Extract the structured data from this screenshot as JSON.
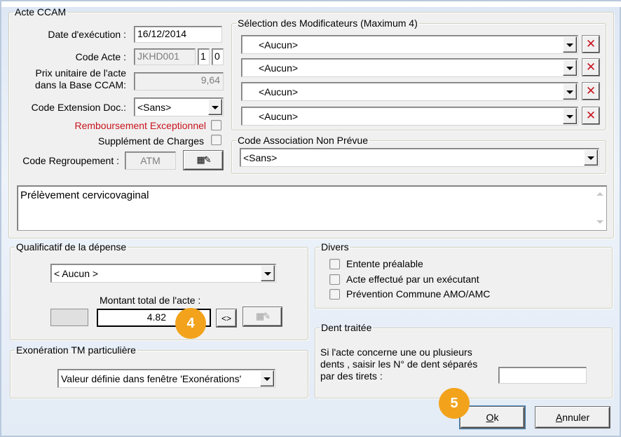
{
  "acte": {
    "legend": "Acte CCAM",
    "date_label": "Date d'exécution :",
    "date_value": "16/12/2014",
    "code_label": "Code Acte :",
    "code_value": "JKHD001",
    "code_phase": "1",
    "code_activite": "0",
    "prix_label_1": "Prix unitaire de l'acte",
    "prix_label_2": "dans la Base CCAM:",
    "prix_value": "9,64",
    "ext_label": "Code Extension Doc.:",
    "ext_value": "<Sans>",
    "remb_label": "Remboursement Exceptionnel",
    "supp_label": "Supplément de Charges",
    "regroup_label": "Code Regroupement :",
    "regroup_value": "ATM",
    "description": "Prélèvement cervicovaginal"
  },
  "modificateurs": {
    "legend": "Sélection des Modificateurs (Maximum 4)",
    "items": [
      {
        "value": "<Aucun>"
      },
      {
        "value": "<Aucun>"
      },
      {
        "value": "<Aucun>"
      },
      {
        "value": "<Aucun>"
      }
    ],
    "delete_glyph": "✕"
  },
  "association": {
    "legend": "Code Association Non Prévue",
    "value": "<Sans>"
  },
  "qualificatif": {
    "legend": "Qualificatif de la dépense",
    "value": "< Aucun >",
    "montant_label": "Montant total de l'acte :",
    "montant_value": "4.82",
    "swap_button": "<>"
  },
  "divers": {
    "legend": "Divers",
    "options": [
      {
        "label": "Entente préalable"
      },
      {
        "label": "Acte effectué par un exécutant"
      },
      {
        "label": "Prévention Commune AMO/AMC"
      }
    ]
  },
  "dent": {
    "legend": "Dent traitée",
    "instruction_1": "Si l'acte concerne une ou plusieurs",
    "instruction_2": "dents , saisir les N° de dent séparés",
    "instruction_3": "par des tirets :",
    "value": ""
  },
  "exoneration": {
    "legend": "Exonération TM particulière",
    "value": "Valeur définie dans fenêtre 'Exonérations'"
  },
  "buttons": {
    "ok_accel": "O",
    "ok_rest": "k",
    "cancel_accel": "A",
    "cancel_rest": "nnuler"
  },
  "badges": {
    "step4": "4",
    "step5": "5"
  },
  "icons": {
    "edit_icon": "▦✎"
  },
  "colors": {
    "badge": "#f2a31b",
    "warning_label": "#c8141e",
    "delete": "#c8141e"
  }
}
